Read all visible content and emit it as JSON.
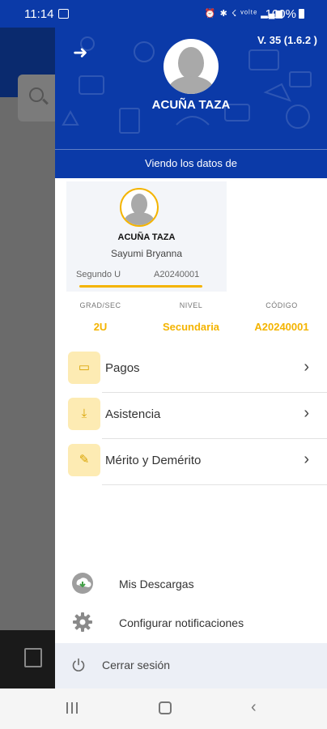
{
  "status_bar": {
    "time": "11:14",
    "signal_icons": "⏰ ✱ ☇ ᵛᵒˡᵗᵉ ▂▄▆",
    "battery": "100%"
  },
  "drawer": {
    "version": "V. 35 (1.6.2 )",
    "header_name": "ACUÑA TAZA",
    "viewing_label": "Viendo los datos de",
    "student": {
      "last_name": "ACUÑA TAZA",
      "first_name": "Sayumi Bryanna",
      "section": "Segundo U",
      "code": "A20240001"
    },
    "info": [
      {
        "label": "GRAD/SEC",
        "value": "2U"
      },
      {
        "label": "NIVEL",
        "value": "Secundaria"
      },
      {
        "label": "CÓDIGO",
        "value": "A20240001"
      }
    ],
    "menu": [
      {
        "label": "Pagos",
        "icon": "money-icon"
      },
      {
        "label": "Asistencia",
        "icon": "attendance-icon"
      },
      {
        "label": "Mérito y Demérito",
        "icon": "merit-icon"
      }
    ],
    "footer": {
      "downloads": "Mis Descargas",
      "notifications": "Configurar notificaciones",
      "logout": "Cerrar sesión"
    }
  },
  "colors": {
    "primary": "#0b3aa8",
    "accent": "#f4b400",
    "icon_bg": "#fdebb3"
  }
}
